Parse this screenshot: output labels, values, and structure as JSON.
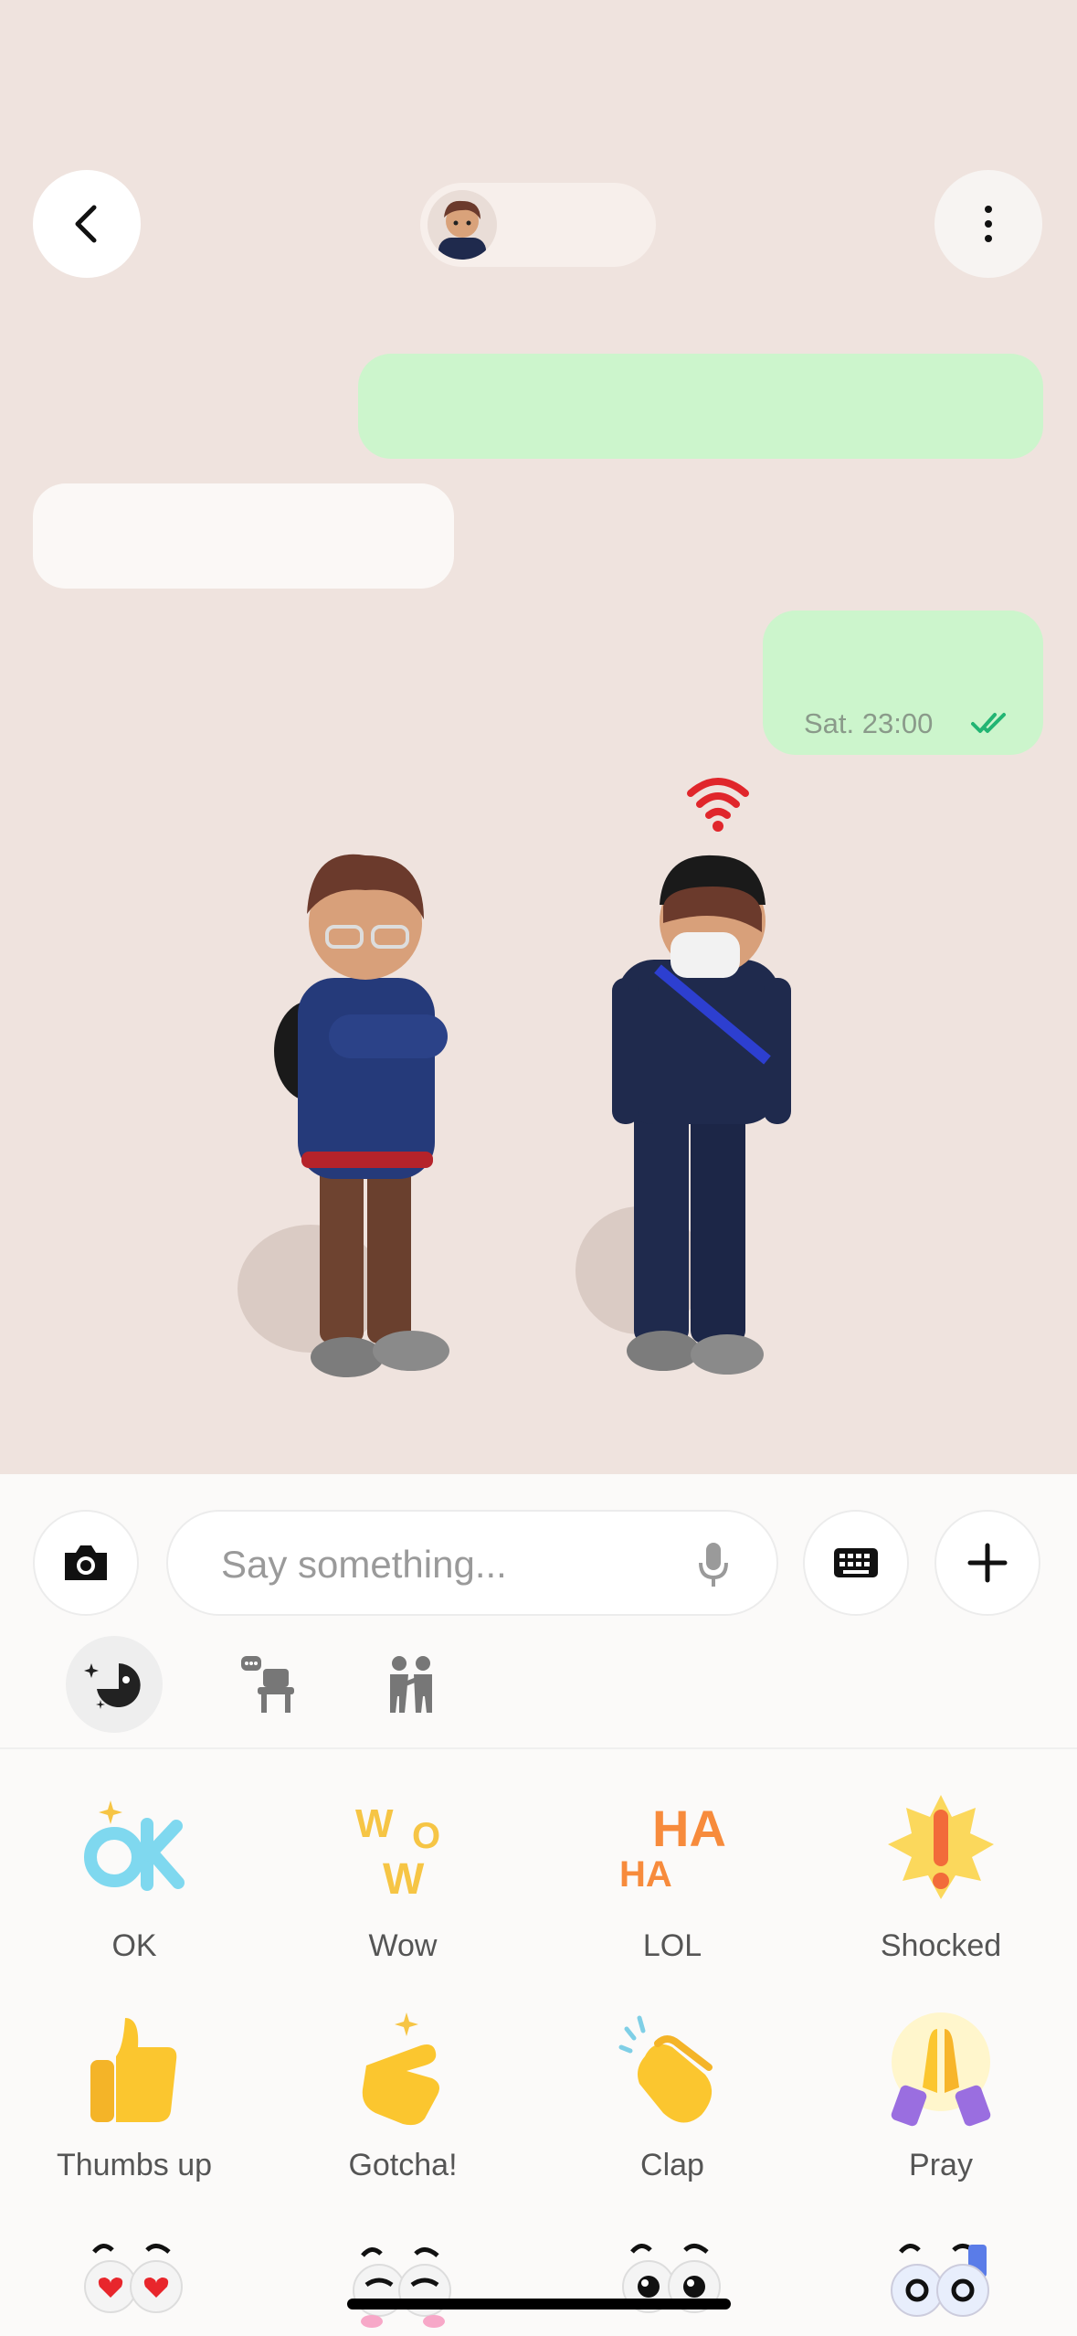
{
  "header": {
    "back_icon": "chevron-left-icon",
    "more_icon": "vertical-ellipsis-icon",
    "contact_name": ""
  },
  "messages": [
    {
      "direction": "out",
      "text": ""
    },
    {
      "direction": "in",
      "text": ""
    },
    {
      "direction": "out",
      "text": "",
      "timestamp": "Sat. 23:00",
      "status_icon": "double-check-icon"
    }
  ],
  "colors": {
    "chat_bg": "#efe3de",
    "outgoing_bubble": "#ccf5cc",
    "incoming_bubble": "#fbf8f6",
    "read_check": "#22b573",
    "panel_bg": "#fbfaf9"
  },
  "composer": {
    "camera_icon": "camera-icon",
    "placeholder": "Say something...",
    "mic_icon": "microphone-icon",
    "keyboard_icon": "keyboard-icon",
    "plus_icon": "plus-icon"
  },
  "tabs": [
    {
      "name": "expressions",
      "icon": "pacman-sparkle-icon",
      "selected": true
    },
    {
      "name": "scenes",
      "icon": "chair-chat-icon",
      "selected": false
    },
    {
      "name": "interactions",
      "icon": "two-people-icon",
      "selected": false
    }
  ],
  "reactions": [
    {
      "label": "OK",
      "icon": "ok-sticker-icon"
    },
    {
      "label": "Wow",
      "icon": "wow-sticker-icon"
    },
    {
      "label": "LOL",
      "icon": "haha-sticker-icon"
    },
    {
      "label": "Shocked",
      "icon": "exclamation-burst-icon"
    },
    {
      "label": "Thumbs up",
      "icon": "thumbs-up-icon"
    },
    {
      "label": "Gotcha!",
      "icon": "finger-point-icon"
    },
    {
      "label": "Clap",
      "icon": "clap-hand-icon"
    },
    {
      "label": "Pray",
      "icon": "pray-hands-icon"
    }
  ],
  "reactions_row3": [
    {
      "icon": "heart-eyes-icon"
    },
    {
      "icon": "shy-eyes-icon"
    },
    {
      "icon": "surprised-eyes-icon"
    },
    {
      "icon": "sweat-eyes-icon"
    }
  ]
}
